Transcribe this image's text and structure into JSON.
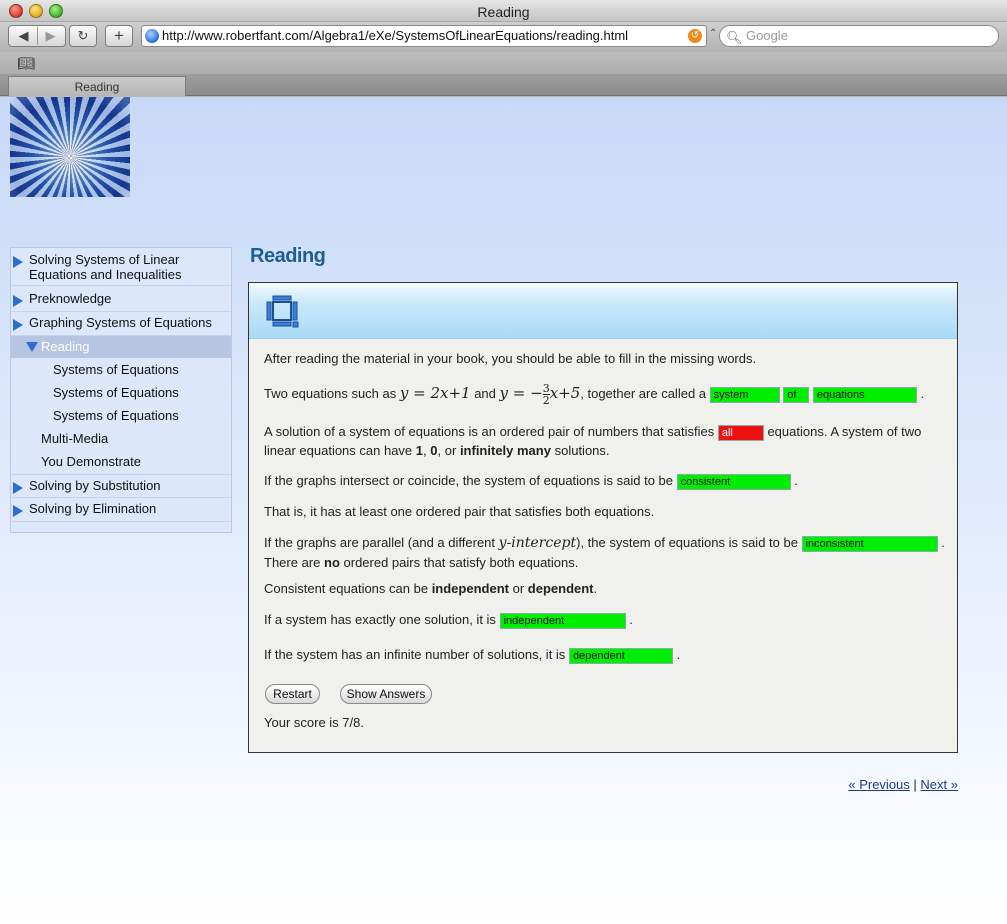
{
  "window": {
    "title": "Reading"
  },
  "toolbar": {
    "url": "http://www.robertfant.com/Algebra1/eXe/SystemsOfLinearEquations/reading.html",
    "search_placeholder": "Google",
    "back_glyph": "◀",
    "forward_glyph": "▶",
    "reload_glyph": "↻",
    "newtab_glyph": "+"
  },
  "tabs": [
    {
      "label": "Reading"
    }
  ],
  "sidebar": {
    "items": [
      {
        "label_line1": "Solving Systems of Linear",
        "label_line2": "Equations and Inequalities"
      },
      {
        "label": "Preknowledge"
      },
      {
        "label": "Graphing Systems of Equations"
      },
      {
        "label": "Reading"
      },
      {
        "label": "Systems of Equations"
      },
      {
        "label": "Systems of Equations"
      },
      {
        "label": "Systems of Equations"
      },
      {
        "label": "Multi-Media"
      },
      {
        "label": "You Demonstrate"
      },
      {
        "label": "Solving by Substitution"
      },
      {
        "label": "Solving by Elimination"
      }
    ]
  },
  "content": {
    "heading": "Reading",
    "intro": "After reading the material in your book, you should be able to fill in the missing words.",
    "q1_prefix": "Two equations such as",
    "q1_eq1": "y = 2x+1",
    "q1_and": "and",
    "q1_eq2_lhs": "y = −",
    "q1_eq2_num": "3",
    "q1_eq2_den": "2",
    "q1_eq2_rhs": "x+5",
    "q1_mid": ", together are called a",
    "q1_blanks": [
      "system",
      "of",
      "equations"
    ],
    "q2_prefix": "A solution of a system of equations is an ordered pair of numbers that satisfies",
    "q2_blank": "all",
    "q2_suffix": "equations. A system of two",
    "q2_line2_a": "linear equations can have",
    "q2_line2_b1": "1",
    "q2_line2_comma1": ",",
    "q2_line2_b2": "0",
    "q2_line2_or": ", or",
    "q2_line2_b3": "infinitely many",
    "q2_line2_end": "solutions.",
    "q3_prefix": "If the graphs intersect or coincide, the system of equations is said to be",
    "q3_blank": "consistent",
    "q4": "That is, it has at least one ordered pair that satisfies both equations.",
    "q5_prefix": "If the graphs are parallel (and a different",
    "q5_italic": "y-intercept",
    "q5_mid": "), the system of equations is said to be",
    "q5_blank": "inconsistent",
    "q5_line2_a": "There are",
    "q5_line2_b": "no",
    "q5_line2_c": "ordered pairs that satisfy both equations.",
    "q6_a": "Consistent equations can be",
    "q6_b": "independent",
    "q6_c": "or",
    "q6_d": "dependent",
    "q6_e": ".",
    "q7_prefix": "If a system has exactly one solution, it is",
    "q7_blank": "independent",
    "q8_prefix": "If the system has an infinite number of solutions, it is",
    "q8_blank": "dependent",
    "period": ".",
    "restart_label": "Restart",
    "show_answers_label": "Show Answers",
    "score": "Your score is 7/8."
  },
  "pager": {
    "previous": "« Previous",
    "separator": "|",
    "next": "Next »"
  },
  "colors": {
    "correct": "#00ee00",
    "incorrect": "#ee1010",
    "heading": "#1f5d98"
  }
}
